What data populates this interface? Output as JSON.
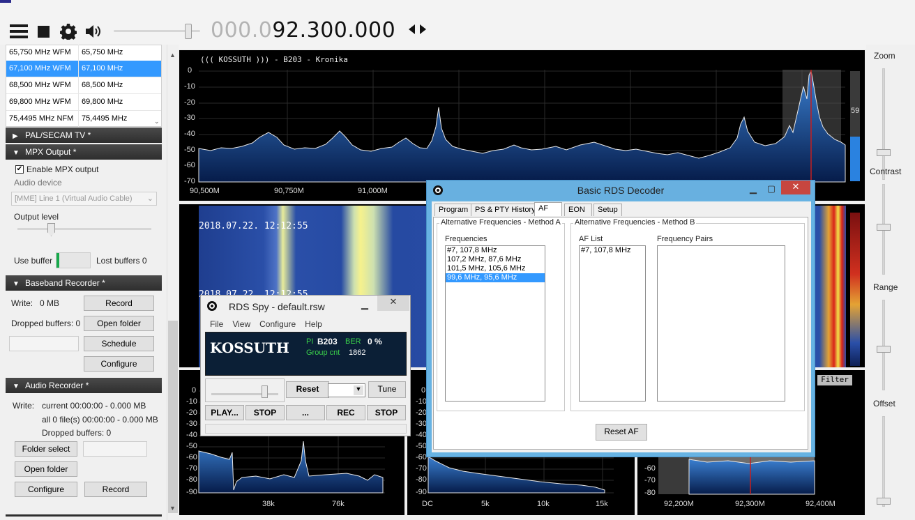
{
  "toolbar": {
    "freq_dim": "000.0",
    "freq_main": "92.300.000",
    "menu_icon": "hamburger-menu-icon",
    "stop_icon": "stop-icon",
    "settings_icon": "gear-icon",
    "volume_icon": "speaker-icon",
    "tune_arrows": "left-right-arrows-icon"
  },
  "freq_list": [
    {
      "name": "65,750 MHz WFM",
      "freq": "65,750 MHz",
      "selected": false
    },
    {
      "name": "67,100 MHz WFM",
      "freq": "67,100 MHz",
      "selected": true
    },
    {
      "name": "68,500 MHz WFM",
      "freq": "68,500 MHz",
      "selected": false
    },
    {
      "name": "69,800 MHz WFM",
      "freq": "69,800 MHz",
      "selected": false
    },
    {
      "name": "75,4495 MHz NFM",
      "freq": "75,4495 MHz",
      "selected": false
    }
  ],
  "sections": {
    "pal": "PAL/SECAM TV *",
    "mpx": "MPX Output *",
    "baseband": "Baseband Recorder *",
    "audio": "Audio Recorder *"
  },
  "mpx": {
    "enable_label": "Enable MPX output",
    "enabled": true,
    "audio_device_label": "Audio device",
    "audio_device": "[MME] Line 1 (Virtual Audio Cable)",
    "output_level_label": "Output level",
    "output_level": 0.4,
    "use_buffer_label": "Use buffer",
    "lost_buffers": "Lost buffers 0"
  },
  "baseband": {
    "write": "Write:",
    "write_value": "0 MB",
    "record": "Record",
    "dropped": "Dropped buffers: 0",
    "open_folder": "Open folder",
    "schedule": "Schedule",
    "configure": "Configure"
  },
  "audio": {
    "write": "Write:",
    "current": "current 00:00:00 - 0.000 MB",
    "all": "all 0 file(s) 00:00:00 - 0.000 MB",
    "dropped": "Dropped buffers: 0",
    "folder_select": "Folder select",
    "open_folder": "Open folder",
    "configure": "Configure",
    "record": "Record"
  },
  "main_spectrum": {
    "rds_text": "((( KOSSUTH  ))) - B203 - Kronika",
    "yticks": [
      "0",
      "-10",
      "-20",
      "-30",
      "-40",
      "-50",
      "-60",
      "-70"
    ],
    "xticks": [
      "90,500M",
      "90,750M",
      "91,000M"
    ],
    "level": "59"
  },
  "waterfall": {
    "ts1": "2018.07.22. 12:12:55",
    "ts2": "2018.07.22. 12:12:55"
  },
  "mpx_spectrum": {
    "yticks": [
      "0",
      "-10",
      "-20",
      "-30",
      "-40",
      "-50",
      "-60",
      "-70",
      "-80",
      "-90"
    ],
    "xticks": [
      "38k",
      "76k"
    ]
  },
  "audio_spectrum": {
    "yticks": [
      "0",
      "-10",
      "-20",
      "-30",
      "-40",
      "-50",
      "-60",
      "-70",
      "-80",
      "-90"
    ],
    "xticks": [
      "DC",
      "5k",
      "10k",
      "15k"
    ]
  },
  "ifft_spectrum": {
    "yticks": [
      "-60",
      "-70",
      "-80"
    ],
    "xticks": [
      "92,200M",
      "92,300M",
      "92,400M"
    ],
    "filter": "Filter"
  },
  "right_labels": {
    "zoom": "Zoom",
    "contrast": "Contrast",
    "range": "Range",
    "offset": "Offset"
  },
  "rds_spy": {
    "title": "RDS Spy - default.rsw",
    "menu": [
      "File",
      "View",
      "Configure",
      "Help"
    ],
    "station": "KOSSUTH",
    "pi_label": "PI",
    "pi": "B203",
    "ber_label": "BER",
    "ber": "0 %",
    "group_label": "Group cnt",
    "group": "1862",
    "reset": "Reset",
    "tune": "Tune",
    "play": "PLAY...",
    "stop": "STOP",
    "dots": "...",
    "rec": "REC",
    "stop2": "STOP"
  },
  "rds_decoder": {
    "title": "Basic RDS Decoder",
    "tabs": [
      "Program",
      "PS & PTY History",
      "AF",
      "EON",
      "Setup"
    ],
    "method_a": "Alternative Frequencies - Method A",
    "method_b": "Alternative Frequencies - Method B",
    "frequencies_label": "Frequencies",
    "frequencies": [
      "#7, 107,8 MHz",
      "107,2 MHz, 87,6 MHz",
      "101,5 MHz, 105,6 MHz",
      "99,6 MHz, 95,6 MHz"
    ],
    "af_list_label": "AF List",
    "af_list": [
      "#7, 107,8 MHz"
    ],
    "pairs_label": "Frequency Pairs",
    "reset_af": "Reset AF"
  }
}
